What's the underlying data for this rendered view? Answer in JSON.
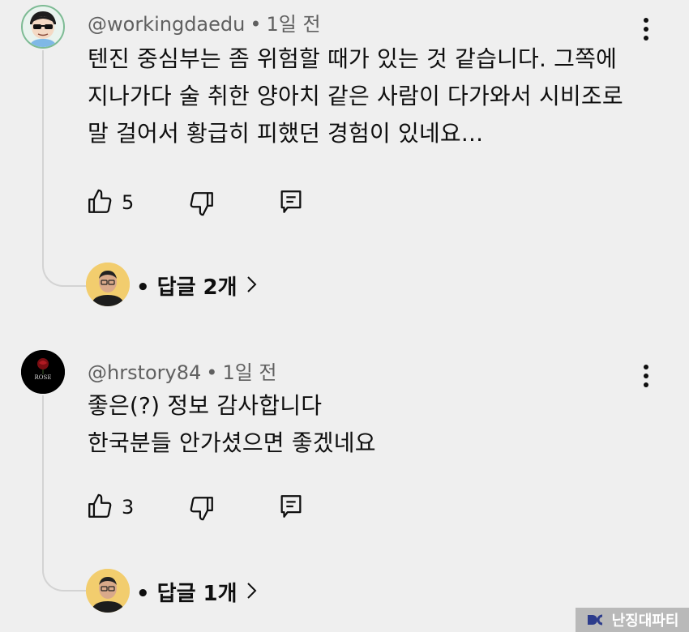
{
  "comments": [
    {
      "handle": "@workingdaedu",
      "separator": "•",
      "time": "1일 전",
      "lines": [
        "텐진 중심부는 좀 위험할 때가 있는 것 같습니다. 그쪽에",
        "지나가다 술 취한 양아치 같은 사람이 다가와서 시비조로",
        "말 걸어서 황급히 피했던 경험이 있네요..."
      ],
      "likes": "5",
      "replies_label": "• 답글 2개"
    },
    {
      "handle": "@hrstory84",
      "separator": "•",
      "time": "1일 전",
      "lines": [
        "좋은(?) 정보 감사합니다",
        "한국분들 안가셨으면 좋겠네요"
      ],
      "likes": "3",
      "replies_label": "• 답글 1개"
    }
  ],
  "avatar_logo_text": "ROSE",
  "watermark": {
    "text": "난징대파티"
  },
  "icons": {
    "like": "thumbs-up-icon",
    "dislike": "thumbs-down-icon",
    "reply": "comment-icon",
    "more": "kebab-menu-icon",
    "expand": "chevron-right-icon"
  },
  "colors": {
    "background": "#efefef",
    "text": "#0f0f0f",
    "meta": "#606060",
    "thread_line": "#d3d3d3"
  }
}
